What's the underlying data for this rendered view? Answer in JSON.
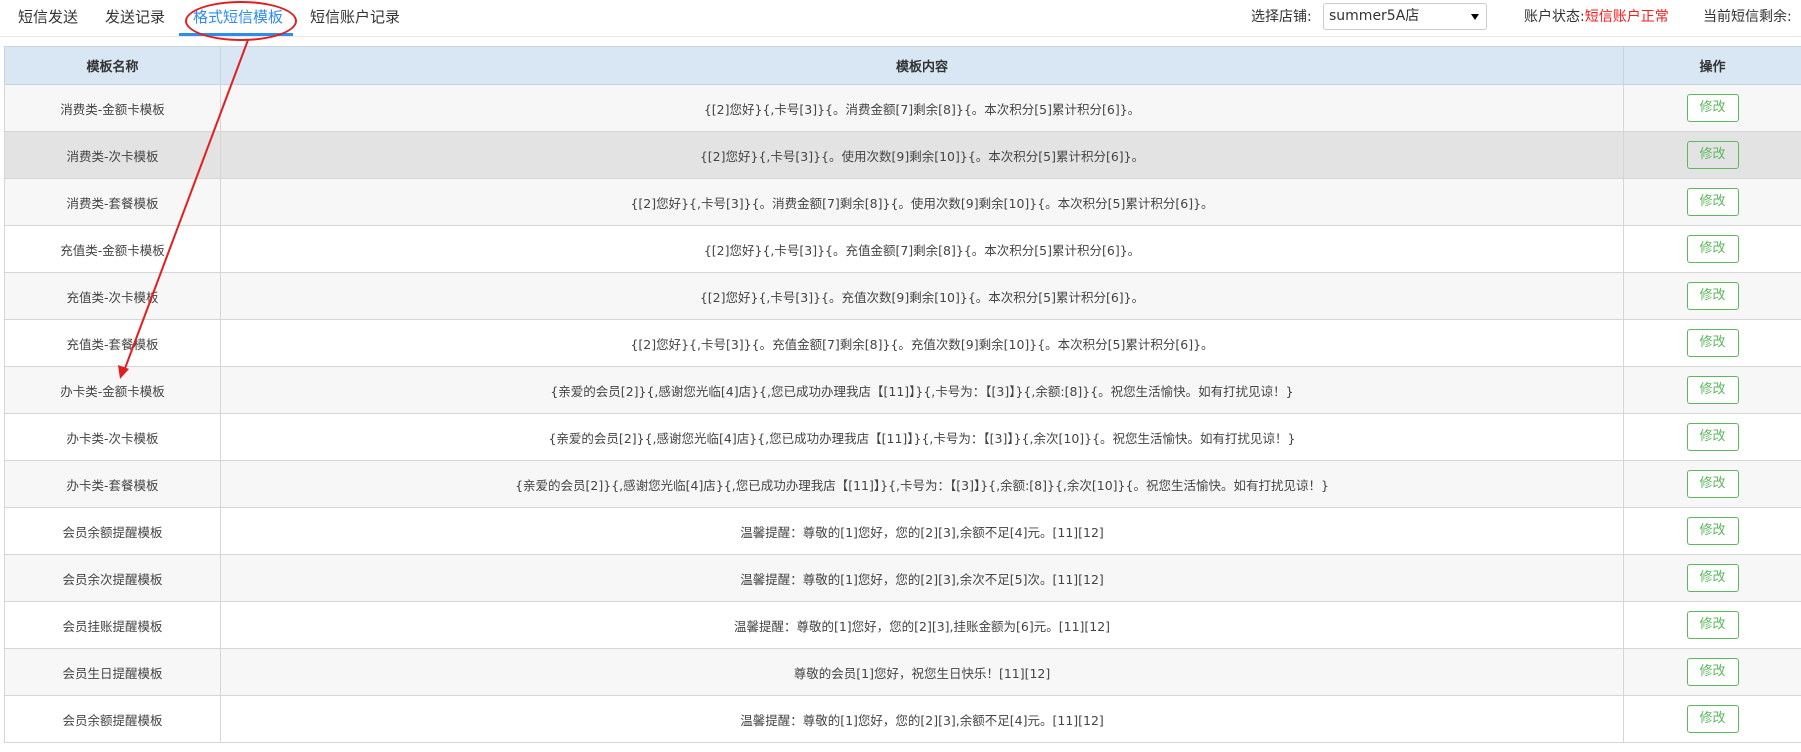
{
  "tabs": [
    {
      "label": "短信发送"
    },
    {
      "label": "发送记录"
    },
    {
      "label": "格式短信模板"
    },
    {
      "label": "短信账户记录"
    }
  ],
  "store": {
    "label": "选择店铺:",
    "value": "summer5A店"
  },
  "account": {
    "label": "账户状态:",
    "status": "短信账户正常"
  },
  "remaining": {
    "label": "当前短信剩余:"
  },
  "table": {
    "headers": [
      "模板名称",
      "模板内容",
      "操作"
    ],
    "edit_label": "修改",
    "rows": [
      {
        "name": "消费类-金额卡模板",
        "content": "{[2]您好}{,卡号[3]}{。消费金额[7]剩余[8]}{。本次积分[5]累计积分[6]}。"
      },
      {
        "name": "消费类-次卡模板",
        "content": "{[2]您好}{,卡号[3]}{。使用次数[9]剩余[10]}{。本次积分[5]累计积分[6]}。"
      },
      {
        "name": "消费类-套餐模板",
        "content": "{[2]您好}{,卡号[3]}{。消费金额[7]剩余[8]}{。使用次数[9]剩余[10]}{。本次积分[5]累计积分[6]}。"
      },
      {
        "name": "充值类-金额卡模板",
        "content": "{[2]您好}{,卡号[3]}{。充值金额[7]剩余[8]}{。本次积分[5]累计积分[6]}。"
      },
      {
        "name": "充值类-次卡模板",
        "content": "{[2]您好}{,卡号[3]}{。充值次数[9]剩余[10]}{。本次积分[5]累计积分[6]}。"
      },
      {
        "name": "充值类-套餐模板",
        "content": "{[2]您好}{,卡号[3]}{。充值金额[7]剩余[8]}{。充值次数[9]剩余[10]}{。本次积分[5]累计积分[6]}。"
      },
      {
        "name": "办卡类-金额卡模板",
        "content": "{亲爱的会员[2]}{,感谢您光临[4]店}{,您已成功办理我店【[11]】}{,卡号为：【[3]】}{,余额:[8]}{。祝您生活愉快。如有打扰见谅！}"
      },
      {
        "name": "办卡类-次卡模板",
        "content": "{亲爱的会员[2]}{,感谢您光临[4]店}{,您已成功办理我店【[11]】}{,卡号为：【[3]】}{,余次[10]}{。祝您生活愉快。如有打扰见谅！}"
      },
      {
        "name": "办卡类-套餐模板",
        "content": "{亲爱的会员[2]}{,感谢您光临[4]店}{,您已成功办理我店【[11]】}{,卡号为：【[3]】}{,余额:[8]}{,余次[10]}{。祝您生活愉快。如有打扰见谅！}"
      },
      {
        "name": "会员余额提醒模板",
        "content": "温馨提醒：尊敬的[1]您好，您的[2][3],余额不足[4]元。[11][12]"
      },
      {
        "name": "会员余次提醒模板",
        "content": "温馨提醒：尊敬的[1]您好，您的[2][3],余次不足[5]次。[11][12]"
      },
      {
        "name": "会员挂账提醒模板",
        "content": "温馨提醒：尊敬的[1]您好，您的[2][3],挂账金额为[6]元。[11][12]"
      },
      {
        "name": "会员生日提醒模板",
        "content": "尊敬的会员[1]您好，祝您生日快乐！[11][12]"
      },
      {
        "name": "会员余额提醒模板",
        "content": "温馨提醒：尊敬的[1]您好，您的[2][3],余额不足[4]元。[11][12]"
      }
    ]
  },
  "colors": {
    "accent": "#2d8cf0",
    "status_ok": "#ff1a1a",
    "edit_button": "#5cb85c",
    "header_bg": "#d9e7f5",
    "annotation": "#e02020"
  }
}
